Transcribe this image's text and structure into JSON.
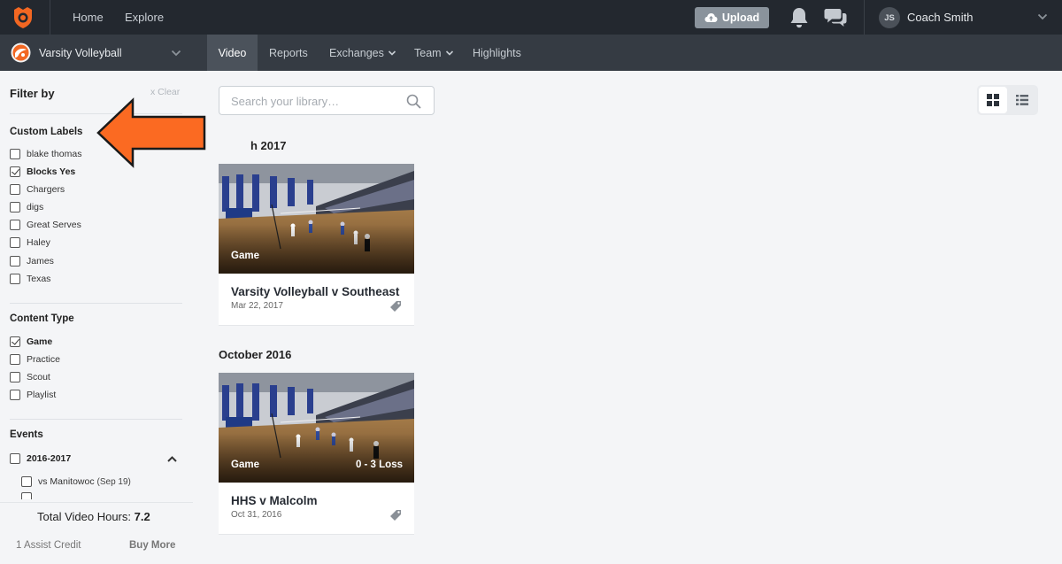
{
  "topbar": {
    "nav": [
      "Home",
      "Explore"
    ],
    "upload_label": "Upload",
    "user": {
      "initials": "JS",
      "name": "Coach Smith"
    }
  },
  "subbar": {
    "team_name": "Varsity Volleyball",
    "tabs": [
      {
        "label": "Video",
        "active": true,
        "dropdown": false
      },
      {
        "label": "Reports",
        "active": false,
        "dropdown": false
      },
      {
        "label": "Exchanges",
        "active": false,
        "dropdown": true
      },
      {
        "label": "Team",
        "active": false,
        "dropdown": true
      },
      {
        "label": "Highlights",
        "active": false,
        "dropdown": false
      }
    ]
  },
  "sidebar": {
    "title": "Filter by",
    "clear_label": "x  Clear",
    "custom_labels": {
      "title": "Custom Labels",
      "items": [
        {
          "label": "blake thomas",
          "checked": false
        },
        {
          "label": "Blocks Yes",
          "checked": true
        },
        {
          "label": "Chargers",
          "checked": false
        },
        {
          "label": "digs",
          "checked": false
        },
        {
          "label": "Great Serves",
          "checked": false
        },
        {
          "label": "Haley",
          "checked": false
        },
        {
          "label": "James",
          "checked": false
        },
        {
          "label": "Texas",
          "checked": false
        }
      ]
    },
    "content_type": {
      "title": "Content Type",
      "items": [
        {
          "label": "Game",
          "checked": true
        },
        {
          "label": "Practice",
          "checked": false
        },
        {
          "label": "Scout",
          "checked": false
        },
        {
          "label": "Playlist",
          "checked": false
        }
      ]
    },
    "events": {
      "title": "Events",
      "season": "2016-2017",
      "sub_items": [
        {
          "label": "vs Manitowoc",
          "date": "(Sep 19)"
        }
      ]
    },
    "footer": {
      "total_label": "Total Video Hours:",
      "total_value": "7.2",
      "assist_credit": "1 Assist Credit",
      "buy_more": "Buy More"
    }
  },
  "main": {
    "search_placeholder": "Search your library…",
    "groups": [
      {
        "month": "h 2017",
        "videos": [
          {
            "type": "Game",
            "score": "",
            "title": "Varsity Volleyball v Southeast",
            "date": "Mar 22, 2017"
          }
        ]
      },
      {
        "month": "October 2016",
        "videos": [
          {
            "type": "Game",
            "score": "0 - 3 Loss",
            "title": "HHS v Malcolm",
            "date": "Oct 31, 2016"
          }
        ]
      }
    ]
  },
  "colors": {
    "topbar_bg": "#23282f",
    "subbar_bg": "#353b43",
    "active_tab_bg": "#4b525b",
    "brand_orange": "#f26722",
    "arrow_orange": "#fb6a22"
  }
}
